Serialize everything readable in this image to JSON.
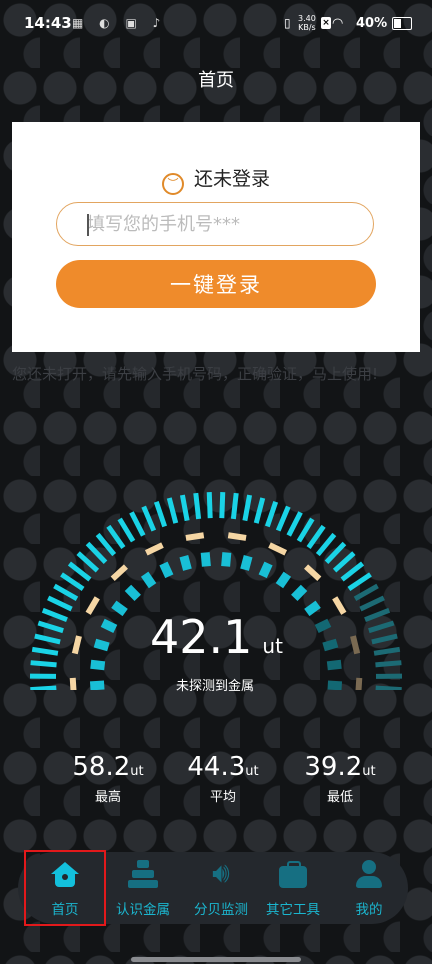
{
  "status_bar": {
    "time": "14:43",
    "speed_value": "3.40",
    "speed_unit": "KB/s",
    "battery": "40%"
  },
  "header": {
    "title": "首页"
  },
  "login": {
    "title": "还未登录",
    "phone_placeholder": "填写您的手机号***",
    "button_label": "一键登录"
  },
  "notice": "您还未打开，请先输入手机号码，正确验证，马上使用!",
  "gauge": {
    "reading": "42.1",
    "unit": "ut",
    "status": "未探测到金属",
    "level_fraction": 0.82,
    "colors": {
      "outer": "#1ad3e6",
      "middle": "#f5d6a4",
      "inner": "#19bfd6"
    }
  },
  "stats": [
    {
      "value": "58.2",
      "unit": "ut",
      "label": "最高"
    },
    {
      "value": "44.3",
      "unit": "ut",
      "label": "平均"
    },
    {
      "value": "39.2",
      "unit": "ut",
      "label": "最低"
    }
  ],
  "nav": [
    {
      "label": "首页",
      "icon": "home-icon",
      "active": true
    },
    {
      "label": "认识金属",
      "icon": "metal-bars-icon",
      "active": false
    },
    {
      "label": "分贝监测",
      "icon": "speaker-icon",
      "active": false
    },
    {
      "label": "其它工具",
      "icon": "toolbox-icon",
      "active": false
    },
    {
      "label": "我的",
      "icon": "user-icon",
      "active": false
    }
  ]
}
